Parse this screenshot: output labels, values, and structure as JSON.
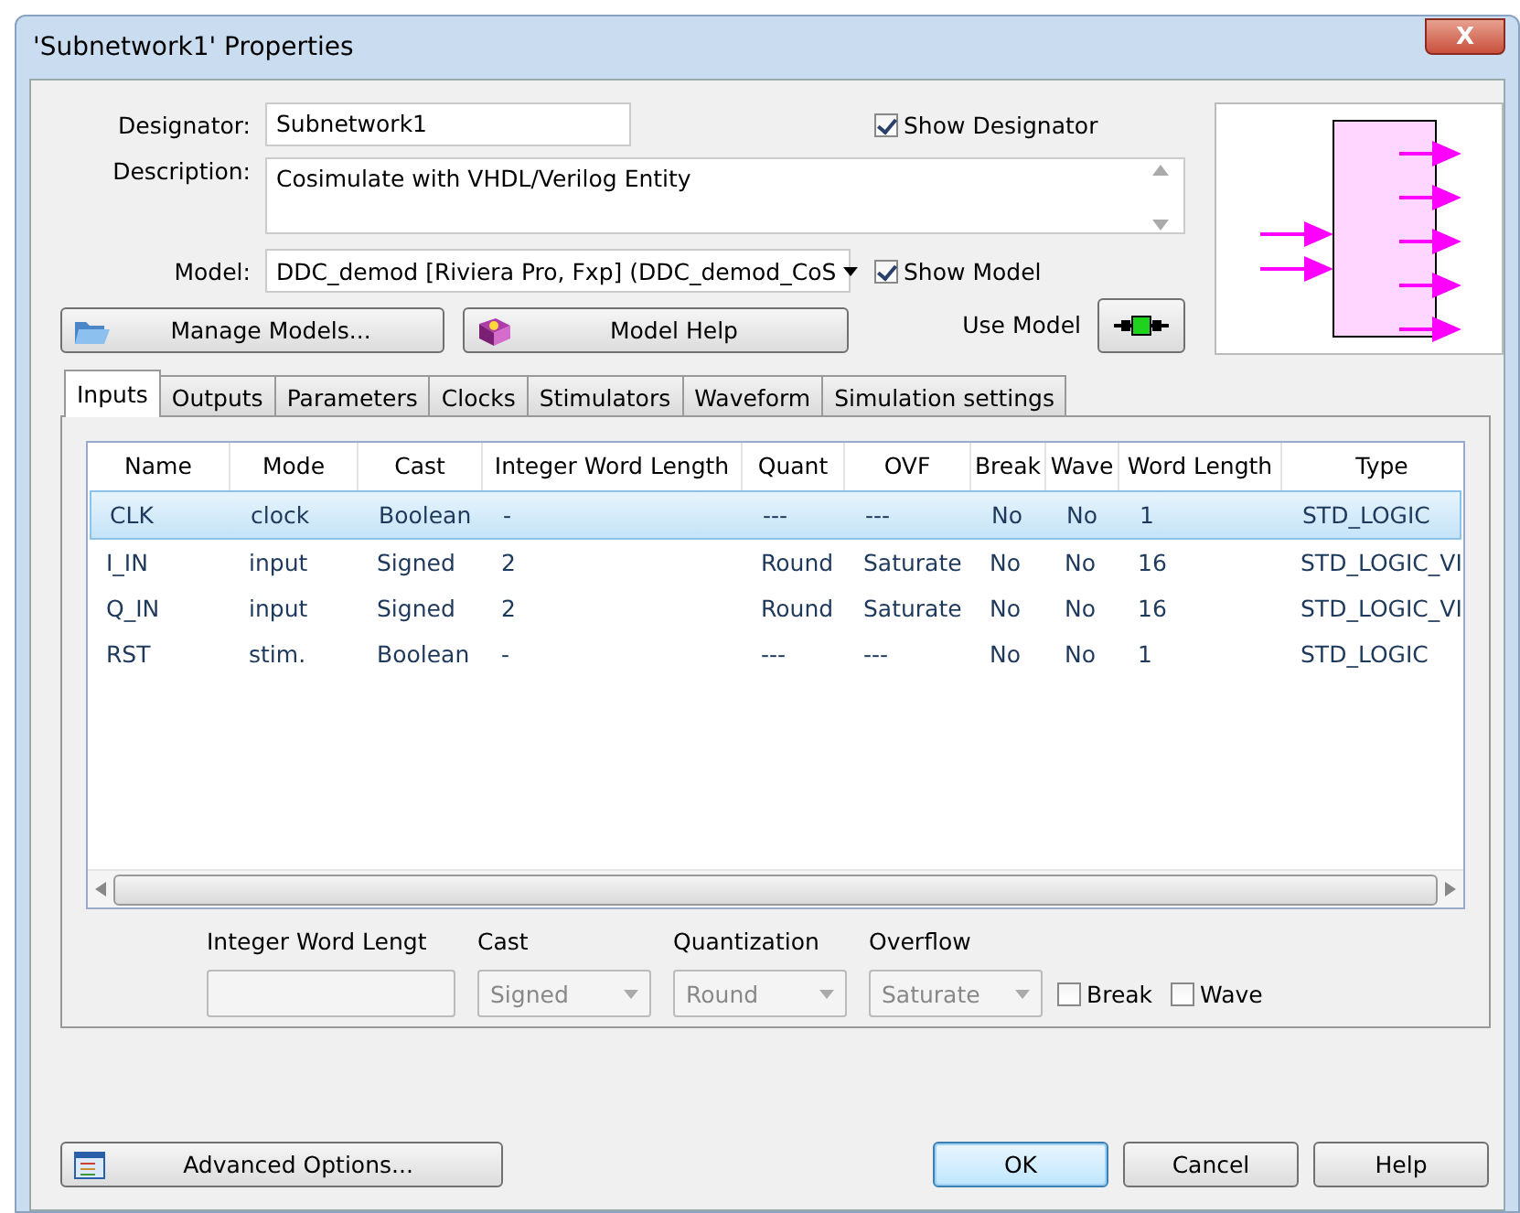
{
  "window": {
    "title": "'Subnetwork1' Properties",
    "close": "X"
  },
  "designator": {
    "label": "Designator:",
    "value": "Subnetwork1",
    "show_label": "Show Designator",
    "show_checked": true
  },
  "description": {
    "label": "Description:",
    "value": "Cosimulate with VHDL/Verilog Entity"
  },
  "model": {
    "label": "Model:",
    "value": "DDC_demod [Riviera Pro, Fxp] (DDC_demod_CoS",
    "show_label": "Show Model",
    "show_checked": true
  },
  "manage_models": {
    "label": "Manage Models..."
  },
  "model_help": {
    "label": "Model Help"
  },
  "use_model": {
    "label": "Use Model"
  },
  "tabs": [
    {
      "label": "Inputs",
      "selected": true
    },
    {
      "label": "Outputs",
      "selected": false
    },
    {
      "label": "Parameters",
      "selected": false
    },
    {
      "label": "Clocks",
      "selected": false
    },
    {
      "label": "Stimulators",
      "selected": false
    },
    {
      "label": "Waveform",
      "selected": false
    },
    {
      "label": "Simulation settings",
      "selected": false
    }
  ],
  "table": {
    "columns": [
      "Name",
      "Mode",
      "Cast",
      "Integer Word Length",
      "Quant",
      "OVF",
      "Break",
      "Wave",
      "Word Length",
      "Type"
    ],
    "rows": [
      {
        "selected": true,
        "cells": [
          "CLK",
          "clock",
          "Boolean",
          "-",
          "---",
          "---",
          "No",
          "No",
          "1",
          "STD_LOGIC"
        ]
      },
      {
        "selected": false,
        "cells": [
          "I_IN",
          "input",
          "Signed",
          "2",
          "Round",
          "Saturate",
          "No",
          "No",
          "16",
          "STD_LOGIC_VI"
        ]
      },
      {
        "selected": false,
        "cells": [
          "Q_IN",
          "input",
          "Signed",
          "2",
          "Round",
          "Saturate",
          "No",
          "No",
          "16",
          "STD_LOGIC_VI"
        ]
      },
      {
        "selected": false,
        "cells": [
          "RST",
          "stim.",
          "Boolean",
          "-",
          "---",
          "---",
          "No",
          "No",
          "1",
          "STD_LOGIC"
        ]
      }
    ]
  },
  "editor": {
    "disabled": true,
    "word_length": {
      "label": "Integer Word Lengt"
    },
    "cast": {
      "label": "Cast",
      "value": "Signed"
    },
    "quantization": {
      "label": "Quantization",
      "value": "Round"
    },
    "overflow": {
      "label": "Overflow",
      "value": "Saturate"
    },
    "break": {
      "label": "Break",
      "checked": false
    },
    "wave": {
      "label": "Wave",
      "checked": false
    }
  },
  "footer": [
    {
      "label": "Advanced Options...",
      "kind": "advanced",
      "default": false
    },
    {
      "label": "OK",
      "kind": "plain",
      "default": true
    },
    {
      "label": "Cancel",
      "kind": "plain",
      "default": false
    },
    {
      "label": "Help",
      "kind": "plain",
      "default": false
    }
  ]
}
